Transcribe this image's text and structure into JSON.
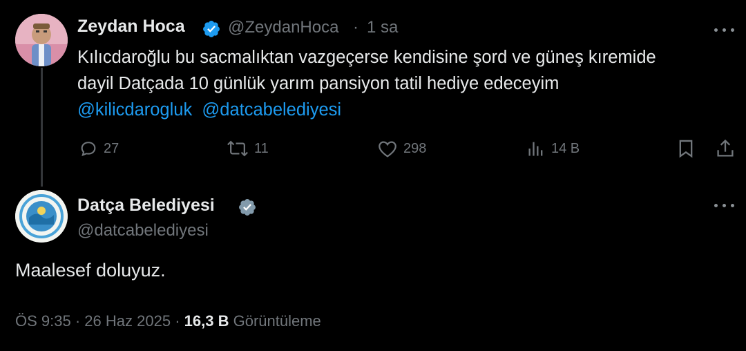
{
  "tweet": {
    "author_name": "Zeydan Hoca",
    "author_handle": "@ZeydanHoca",
    "time_separator": "·",
    "time_ago": "1 sa",
    "text_lines": [
      "Kılıcdaroğlu bu sacmalıktan  vazgeçerse  kendisine şord ve güneş kıremide",
      "dayil Datçada  10 günlük yarım pansiyon tatil hediye edeceyim"
    ],
    "mentions": [
      "@kilicdarogluk",
      "@datcabelediyesi"
    ],
    "actions": {
      "replies": "27",
      "retweets": "11",
      "likes": "298",
      "views": "14 B"
    }
  },
  "reply": {
    "author_name": "Datça Belediyesi",
    "author_handle": "@datcabelediyesi",
    "text": "Maalesef doluyuz.",
    "time": "ÖS 9:35",
    "separator": "·",
    "date": "26 Haz 2025",
    "separator2": "·",
    "view_count": "16,3 B",
    "view_label": "Görüntüleme"
  },
  "colors": {
    "background": "#000000",
    "text": "#e7e9ea",
    "secondary": "#71767b",
    "link": "#1d9bf0",
    "verified": "#1d9bf0",
    "verified_gov": "#829aab"
  },
  "icons": [
    "verified-badge-icon",
    "more-icon",
    "reply-icon",
    "retweet-icon",
    "like-icon",
    "views-icon",
    "bookmark-icon",
    "share-icon"
  ]
}
